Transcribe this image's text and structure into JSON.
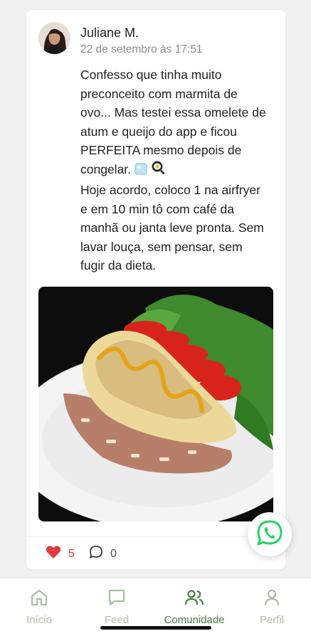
{
  "post": {
    "author": "Juliane M.",
    "date": "22 de setembro às 17:51",
    "text_lines": [
      "Confesso que tinha muito",
      "preconceito com marmita de",
      "ovo... Mas testei essa omelete de",
      "atum e queijo do app e ficou",
      "PERFEITA mesmo depois de",
      "congelar.",
      "Hoje acordo, coloco 1 na airfryer",
      "e em 10 min tô com café da",
      "manhã ou janta leve pronta. Sem",
      "lavar louça, sem pensar, sem",
      "fugir da dieta."
    ],
    "emojis": [
      "ice-cube-icon",
      "frying-pan-egg-icon"
    ],
    "likes": "5",
    "comments": "0",
    "liked": true
  },
  "tabs": [
    {
      "label": "Início",
      "icon": "home-icon",
      "active": false
    },
    {
      "label": "Feed",
      "icon": "chat-bubble-icon",
      "active": false
    },
    {
      "label": "Comunidade",
      "icon": "users-icon",
      "active": true
    },
    {
      "label": "Perfil",
      "icon": "person-icon",
      "active": false
    }
  ],
  "colors": {
    "accent": "#4d7c49",
    "inactive_tab": "#a9c0a4",
    "like": "#e03b3b",
    "whatsapp": "#25d366"
  }
}
